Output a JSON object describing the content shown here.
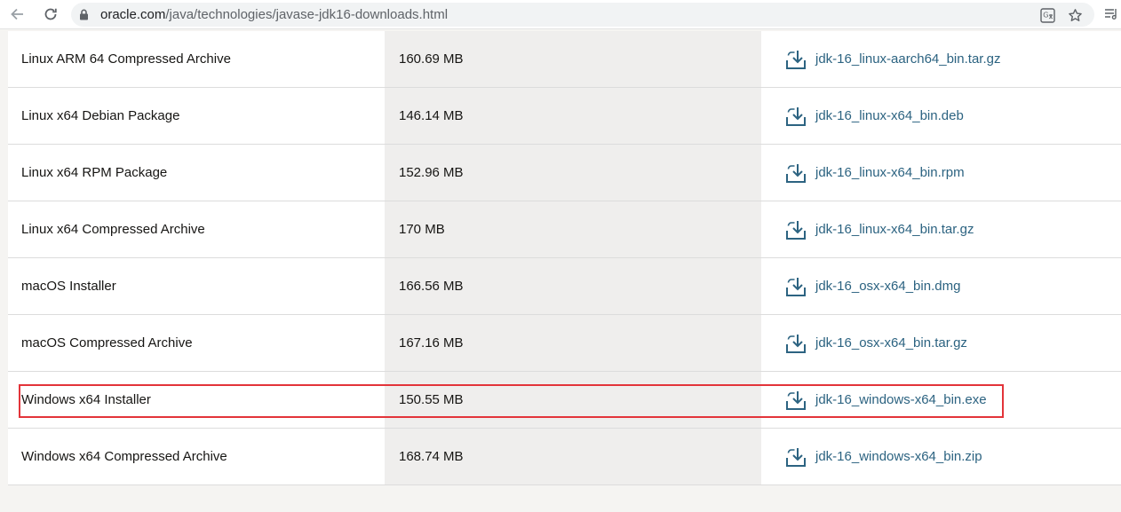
{
  "browser": {
    "url_host": "oracle.com",
    "url_path": "/java/technologies/javase-jdk16-downloads.html",
    "icons": {
      "back": "arrow-left-icon",
      "reload": "reload-icon",
      "lock": "lock-icon",
      "translate": "translate-icon",
      "bookmark": "star-icon",
      "menu": "reading-list-icon"
    }
  },
  "downloads": [
    {
      "product": "Linux ARM 64 Compressed Archive",
      "size": "160.69 MB",
      "file": "jdk-16_linux-aarch64_bin.tar.gz"
    },
    {
      "product": "Linux x64 Debian Package",
      "size": "146.14 MB",
      "file": "jdk-16_linux-x64_bin.deb"
    },
    {
      "product": "Linux x64 RPM Package",
      "size": "152.96 MB",
      "file": "jdk-16_linux-x64_bin.rpm"
    },
    {
      "product": "Linux x64 Compressed Archive",
      "size": "170 MB",
      "file": "jdk-16_linux-x64_bin.tar.gz"
    },
    {
      "product": "macOS Installer",
      "size": "166.56 MB",
      "file": "jdk-16_osx-x64_bin.dmg"
    },
    {
      "product": "macOS Compressed Archive",
      "size": "167.16 MB",
      "file": "jdk-16_osx-x64_bin.tar.gz"
    },
    {
      "product": "Windows x64 Installer",
      "size": "150.55 MB",
      "file": "jdk-16_windows-x64_bin.exe"
    },
    {
      "product": "Windows x64 Compressed Archive",
      "size": "168.74 MB",
      "file": "jdk-16_windows-x64_bin.zip"
    }
  ],
  "colors": {
    "link": "#2c6381",
    "highlight_border": "#e3343a",
    "size_column_bg": "#efeeed"
  }
}
